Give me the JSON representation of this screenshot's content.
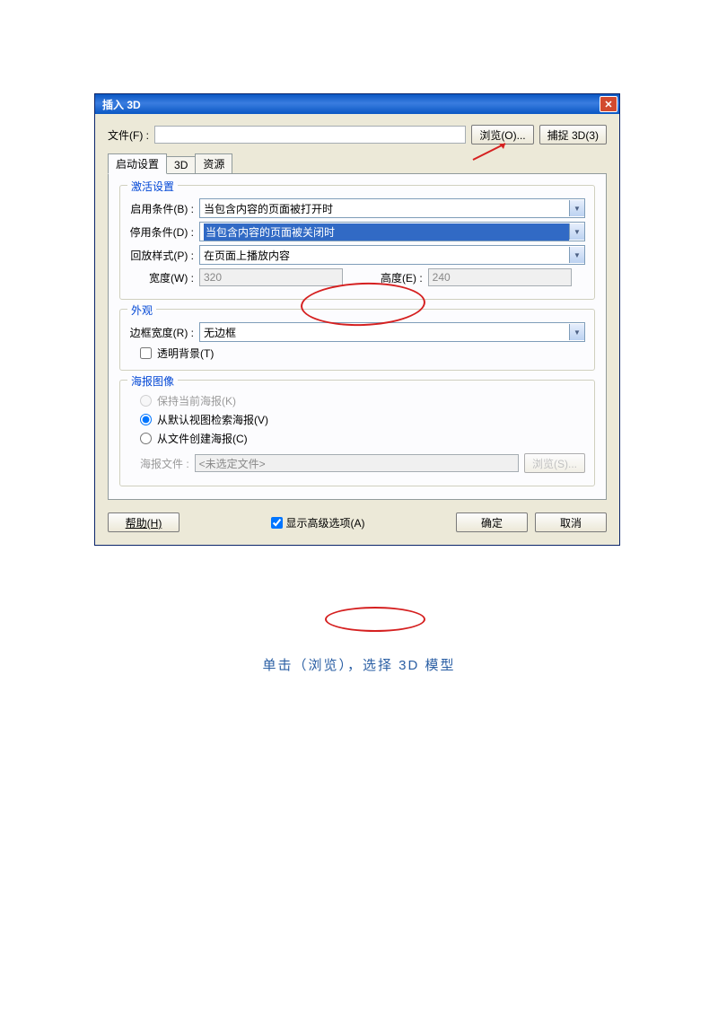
{
  "dialog": {
    "title": "插入 3D",
    "file_label": "文件(F) :",
    "browse_btn": "浏览(O)...",
    "capture_btn": "捕捉 3D(3)",
    "tabs": {
      "t1": "启动设置",
      "t2": "3D",
      "t3": "资源"
    },
    "activation": {
      "group": "激活设置",
      "enable_lbl": "启用条件(B) :",
      "enable_val": "当包含内容的页面被打开时",
      "disable_lbl": "停用条件(D) :",
      "disable_val": "当包含内容的页面被关闭时",
      "playback_lbl": "回放样式(P) :",
      "playback_val": "在页面上播放内容",
      "width_lbl": "宽度(W) :",
      "width_val": "320",
      "height_lbl": "高度(E) :",
      "height_val": "240"
    },
    "appearance": {
      "group": "外观",
      "border_lbl": "边框宽度(R) :",
      "border_val": "无边框",
      "transparent_lbl": "透明背景(T)"
    },
    "poster": {
      "group": "海报图像",
      "keep_lbl": "保持当前海报(K)",
      "default_lbl": "从默认视图检索海报(V)",
      "file_lbl": "从文件创建海报(C)",
      "poster_file_lbl": "海报文件 :",
      "poster_file_ph": "<未选定文件>",
      "poster_browse": "浏览(S)..."
    },
    "footer": {
      "help": "帮助(H)",
      "advanced": "显示高级选项(A)",
      "ok": "确定",
      "cancel": "取消"
    }
  },
  "caption": "单击（浏览），选择 3D 模型"
}
